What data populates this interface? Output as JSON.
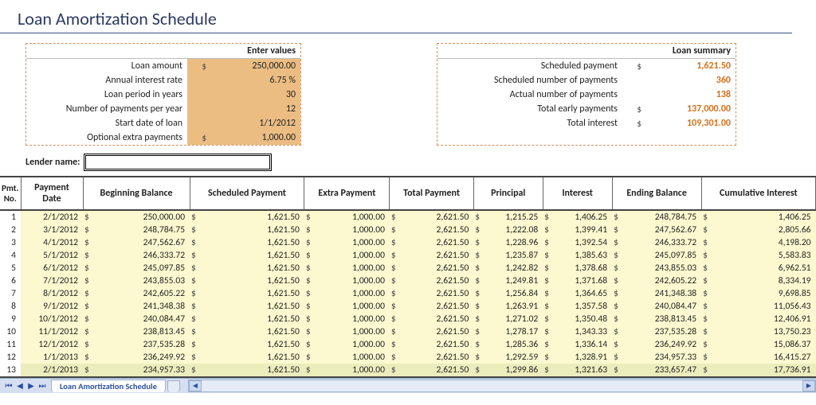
{
  "title": "Loan Amortization Schedule",
  "inputs_header": "Enter values",
  "inputs": {
    "loan_amount": {
      "label": "Loan amount",
      "cur": "$",
      "value": "250,000.00"
    },
    "annual_rate": {
      "label": "Annual interest rate",
      "cur": "",
      "value": "6.75  %"
    },
    "period_years": {
      "label": "Loan period in years",
      "cur": "",
      "value": "30"
    },
    "payments_per_year": {
      "label": "Number of payments per year",
      "cur": "",
      "value": "12"
    },
    "start_date": {
      "label": "Start date of loan",
      "cur": "",
      "value": "1/1/2012"
    },
    "extra_payments": {
      "label": "Optional extra payments",
      "cur": "$",
      "value": "1,000.00"
    }
  },
  "lender_label": "Lender name:",
  "summary_header": "Loan summary",
  "summary": {
    "scheduled_payment": {
      "label": "Scheduled payment",
      "cur": "$",
      "value": "1,621.50"
    },
    "num_payments": {
      "label": "Scheduled number of payments",
      "cur": "",
      "value": "360"
    },
    "actual_payments": {
      "label": "Actual number of payments",
      "cur": "",
      "value": "138"
    },
    "early_payments": {
      "label": "Total early payments",
      "cur": "$",
      "value": "137,000.00"
    },
    "total_interest": {
      "label": "Total interest",
      "cur": "$",
      "value": "109,301.00"
    }
  },
  "columns": [
    "Pmt. No.",
    "Payment Date",
    "Beginning Balance",
    "Scheduled Payment",
    "Extra Payment",
    "Total Payment",
    "Principal",
    "Interest",
    "Ending Balance",
    "Cumulative Interest"
  ],
  "rows": [
    {
      "no": "1",
      "date": "2/1/2012",
      "beg": "250,000.00",
      "sched": "1,621.50",
      "extra": "1,000.00",
      "total": "2,621.50",
      "princ": "1,215.25",
      "int": "1,406.25",
      "end": "248,784.75",
      "cum": "1,406.25"
    },
    {
      "no": "2",
      "date": "3/1/2012",
      "beg": "248,784.75",
      "sched": "1,621.50",
      "extra": "1,000.00",
      "total": "2,621.50",
      "princ": "1,222.08",
      "int": "1,399.41",
      "end": "247,562.67",
      "cum": "2,805.66"
    },
    {
      "no": "3",
      "date": "4/1/2012",
      "beg": "247,562.67",
      "sched": "1,621.50",
      "extra": "1,000.00",
      "total": "2,621.50",
      "princ": "1,228.96",
      "int": "1,392.54",
      "end": "246,333.72",
      "cum": "4,198.20"
    },
    {
      "no": "4",
      "date": "5/1/2012",
      "beg": "246,333.72",
      "sched": "1,621.50",
      "extra": "1,000.00",
      "total": "2,621.50",
      "princ": "1,235.87",
      "int": "1,385.63",
      "end": "245,097.85",
      "cum": "5,583.83"
    },
    {
      "no": "5",
      "date": "6/1/2012",
      "beg": "245,097.85",
      "sched": "1,621.50",
      "extra": "1,000.00",
      "total": "2,621.50",
      "princ": "1,242.82",
      "int": "1,378.68",
      "end": "243,855.03",
      "cum": "6,962.51"
    },
    {
      "no": "6",
      "date": "7/1/2012",
      "beg": "243,855.03",
      "sched": "1,621.50",
      "extra": "1,000.00",
      "total": "2,621.50",
      "princ": "1,249.81",
      "int": "1,371.68",
      "end": "242,605.22",
      "cum": "8,334.19"
    },
    {
      "no": "7",
      "date": "8/1/2012",
      "beg": "242,605.22",
      "sched": "1,621.50",
      "extra": "1,000.00",
      "total": "2,621.50",
      "princ": "1,256.84",
      "int": "1,364.65",
      "end": "241,348.38",
      "cum": "9,698.85"
    },
    {
      "no": "8",
      "date": "9/1/2012",
      "beg": "241,348.38",
      "sched": "1,621.50",
      "extra": "1,000.00",
      "total": "2,621.50",
      "princ": "1,263.91",
      "int": "1,357.58",
      "end": "240,084.47",
      "cum": "11,056.43"
    },
    {
      "no": "9",
      "date": "10/1/2012",
      "beg": "240,084.47",
      "sched": "1,621.50",
      "extra": "1,000.00",
      "total": "2,621.50",
      "princ": "1,271.02",
      "int": "1,350.48",
      "end": "238,813.45",
      "cum": "12,406.91"
    },
    {
      "no": "10",
      "date": "11/1/2012",
      "beg": "238,813.45",
      "sched": "1,621.50",
      "extra": "1,000.00",
      "total": "2,621.50",
      "princ": "1,278.17",
      "int": "1,343.33",
      "end": "237,535.28",
      "cum": "13,750.23"
    },
    {
      "no": "11",
      "date": "12/1/2012",
      "beg": "237,535.28",
      "sched": "1,621.50",
      "extra": "1,000.00",
      "total": "2,621.50",
      "princ": "1,285.36",
      "int": "1,336.14",
      "end": "236,249.92",
      "cum": "15,086.37"
    },
    {
      "no": "12",
      "date": "1/1/2013",
      "beg": "236,249.92",
      "sched": "1,621.50",
      "extra": "1,000.00",
      "total": "2,621.50",
      "princ": "1,292.59",
      "int": "1,328.91",
      "end": "234,957.33",
      "cum": "16,415.27"
    },
    {
      "no": "13",
      "date": "2/1/2013",
      "beg": "234,957.33",
      "sched": "1,621.50",
      "extra": "1,000.00",
      "total": "2,621.50",
      "princ": "1,299.86",
      "int": "1,321.63",
      "end": "233,657.47",
      "cum": "17,736.91"
    }
  ],
  "tab_name": "Loan Amortization Schedule"
}
